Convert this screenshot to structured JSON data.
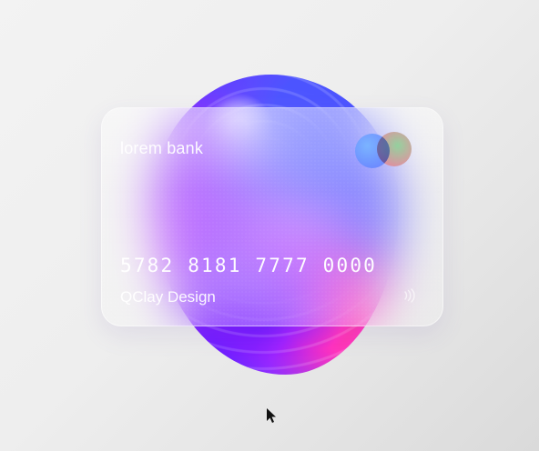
{
  "card": {
    "bank_name": "lorem bank",
    "number": "5782 8181 7777 0000",
    "holder": "QClay Design"
  },
  "icons": {
    "logo": "circles-logo-icon",
    "contactless": "contactless-icon",
    "cursor": "mouse-pointer-icon"
  },
  "colors": {
    "background": "#efefef",
    "card_text": "#ffffff",
    "blob_primary": "#7f35ff",
    "blob_accent": "#ff5cf4",
    "logo_blue": "#6c8dff",
    "logo_green": "#8fd096",
    "logo_pink": "#ff7296"
  }
}
